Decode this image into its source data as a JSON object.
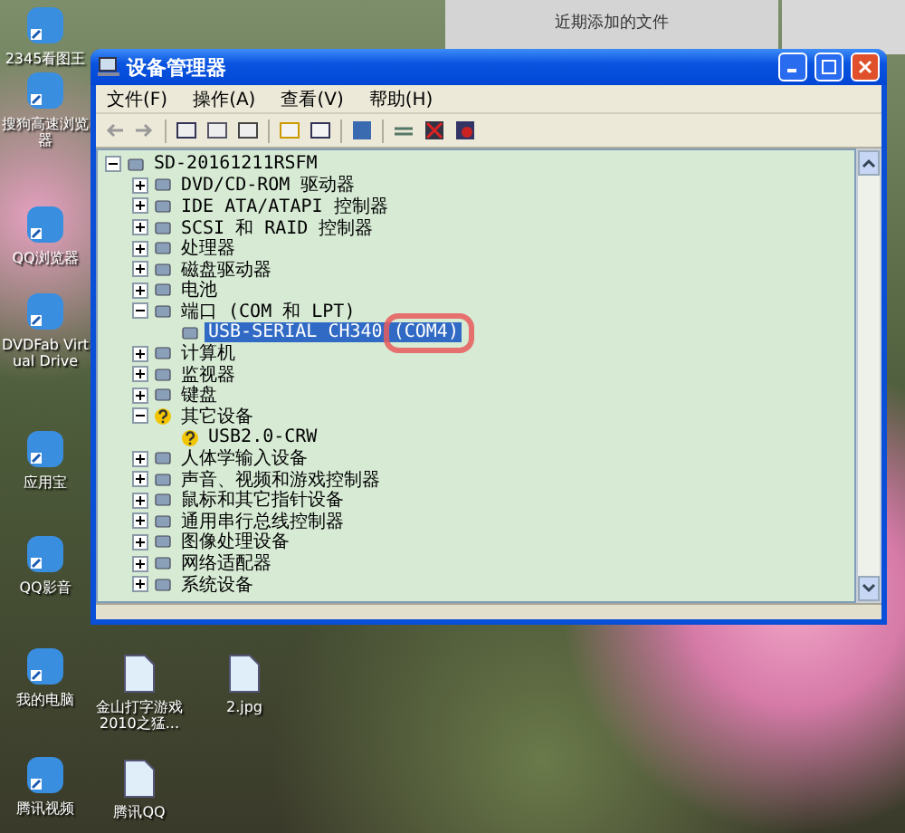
{
  "desktop_icons_left": [
    {
      "label": "2345看图王"
    },
    {
      "label": "搜狗高速浏览器"
    },
    {
      "label": "QQ浏览器"
    },
    {
      "label": "DVDFab Virtual Drive"
    },
    {
      "label": "应用宝"
    },
    {
      "label": "QQ影音"
    },
    {
      "label": "我的电脑"
    },
    {
      "label": "腾讯视频"
    }
  ],
  "desktop_icons_bottom": [
    {
      "label": "金山打字游戏2010之猛..."
    },
    {
      "label": "2.jpg"
    },
    {
      "label": "腾讯QQ"
    }
  ],
  "background_window": {
    "title": "近期添加的文件"
  },
  "window": {
    "title": "设备管理器"
  },
  "menu": [
    "文件(F)",
    "操作(A)",
    "查看(V)",
    "帮助(H)"
  ],
  "tree": [
    {
      "label": "SD-20161211RSFM",
      "expanded": true,
      "selected": false,
      "children": [
        {
          "label": "DVD/CD-ROM 驱动器",
          "expanded": false,
          "selected": false
        },
        {
          "label": "IDE ATA/ATAPI 控制器",
          "expanded": false,
          "selected": false
        },
        {
          "label": "SCSI 和 RAID 控制器",
          "expanded": false,
          "selected": false
        },
        {
          "label": "处理器",
          "expanded": false,
          "selected": false
        },
        {
          "label": "磁盘驱动器",
          "expanded": false,
          "selected": false
        },
        {
          "label": "电池",
          "expanded": false,
          "selected": false
        },
        {
          "label": "端口 (COM 和 LPT)",
          "expanded": true,
          "selected": false,
          "children": [
            {
              "label": "USB-SERIAL CH340 (COM4)",
              "selected": true,
              "circled": true
            }
          ]
        },
        {
          "label": "计算机",
          "expanded": false,
          "selected": false
        },
        {
          "label": "监视器",
          "expanded": false,
          "selected": false
        },
        {
          "label": "键盘",
          "expanded": false,
          "selected": false
        },
        {
          "label": "其它设备",
          "expanded": true,
          "selected": false,
          "warning": true,
          "children": [
            {
              "label": "USB2.0-CRW",
              "selected": false,
              "warning": true
            }
          ]
        },
        {
          "label": "人体学输入设备",
          "expanded": false,
          "selected": false
        },
        {
          "label": "声音、视频和游戏控制器",
          "expanded": false,
          "selected": false
        },
        {
          "label": "鼠标和其它指针设备",
          "expanded": false,
          "selected": false
        },
        {
          "label": "通用串行总线控制器",
          "expanded": false,
          "selected": false
        },
        {
          "label": "图像处理设备",
          "expanded": false,
          "selected": false
        },
        {
          "label": "网络适配器",
          "expanded": false,
          "selected": false
        },
        {
          "label": "系统设备",
          "expanded": false,
          "selected": false
        }
      ]
    }
  ]
}
